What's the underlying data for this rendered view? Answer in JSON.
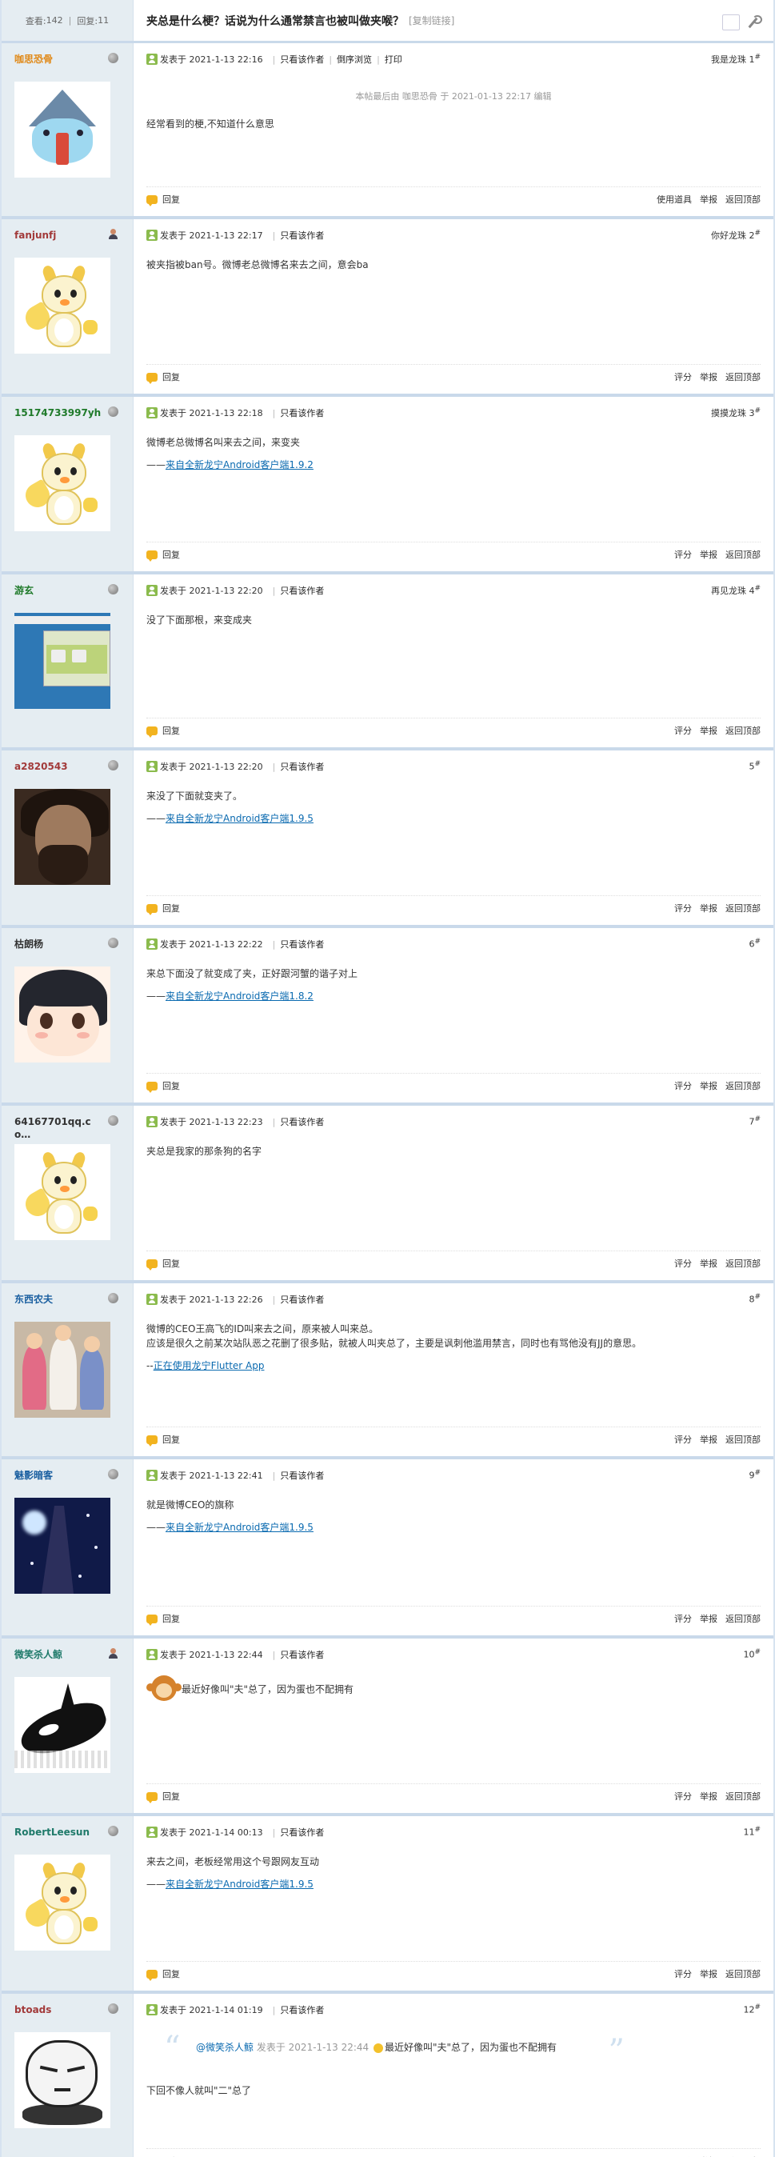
{
  "header": {
    "views_label": "查看:",
    "views_value": "142",
    "replies_label": "回复:",
    "replies_value": "11",
    "title": "夹总是什么梗？话说为什么通常禁言也被叫做夹喉？",
    "copy_link": "[复制链接]"
  },
  "labels": {
    "posted_at": "发表于",
    "only_author": "只看该作者",
    "reverse_view": "倒序浏览",
    "print": "打印",
    "reply": "回复",
    "use_tool": "使用道具",
    "rate": "评分",
    "report": "举报",
    "back_to_top": "返回顶部"
  },
  "colors": {
    "sidebar_bg": "#e5edf2",
    "border": "#c9d9ea",
    "link": "#0a6ab0"
  },
  "posts": [
    {
      "username": "咖思恐骨",
      "username_color": "#e08a1a",
      "time": "2021-1-13 22:16",
      "floor": "我是龙珠 1",
      "floor_sup": "#",
      "edit_note": "本帖最后由 咖思恐骨 于 2021-01-13 22:17 编辑",
      "body": "经常看到的梗,不知道什么意思"
    },
    {
      "username": "fanjunfj",
      "username_color": "#a23a3a",
      "time": "2021-1-13 22:17",
      "floor": "你好龙珠 2",
      "floor_sup": "#",
      "body": "被夹指被ban号。微博老总微博名来去之间，意会ba"
    },
    {
      "username": "15174733997yh",
      "username_color": "#1f7a2a",
      "time": "2021-1-13 22:18",
      "floor": "摸摸龙珠 3",
      "floor_sup": "#",
      "body": "微博老总微博名叫来去之间，来变夹",
      "sig_prefix": "——",
      "sig_link": "来自全新龙宁Android客户端1.9.2"
    },
    {
      "username": "游玄",
      "username_color": "#1f7a2a",
      "time": "2021-1-13 22:20",
      "floor": "再见龙珠 4",
      "floor_sup": "#",
      "body": "没了下面那根，来变成夹"
    },
    {
      "username": "a2820543",
      "username_color": "#a23a3a",
      "time": "2021-1-13 22:20",
      "floor": "5",
      "floor_sup": "#",
      "body": "来没了下面就变夹了。",
      "sig_prefix": "——",
      "sig_link": "来自全新龙宁Android客户端1.9.5"
    },
    {
      "username": "枯朗杨",
      "username_color": "#333333",
      "time": "2021-1-13 22:22",
      "floor": "6",
      "floor_sup": "#",
      "body": "来总下面没了就变成了夹，正好跟河蟹的谐子对上",
      "sig_prefix": "——",
      "sig_link": "来自全新龙宁Android客户端1.8.2"
    },
    {
      "username": "64167701qq.co…",
      "username_color": "#333333",
      "time": "2021-1-13 22:23",
      "floor": "7",
      "floor_sup": "#",
      "body": "夹总是我家的那条狗的名字"
    },
    {
      "username": "东西农夫",
      "username_color": "#1a5fa0",
      "time": "2021-1-13 22:26",
      "floor": "8",
      "floor_sup": "#",
      "body": "微博的CEO王高飞的ID叫来去之间，原来被人叫来总。",
      "body2": "应该是很久之前某次站队恶之花删了很多贴，就被人叫夹总了，主要是讽刺他滥用禁言，同时也有骂他没有JJ的意思。",
      "sig_prefix": "--",
      "sig_link": "正在使用龙宁Flutter App"
    },
    {
      "username": "魅影暗客",
      "username_color": "#1a5fa0",
      "time": "2021-1-13 22:41",
      "floor": "9",
      "floor_sup": "#",
      "body": "就是微博CEO的旗称",
      "sig_prefix": "——",
      "sig_link": "来自全新龙宁Android客户端1.9.5"
    },
    {
      "username": "微笑杀人鲸",
      "username_color": "#1f7a6a",
      "time": "2021-1-13 22:44",
      "floor": "10",
      "floor_sup": "#",
      "body": "最近好像叫\"夫\"总了，因为蛋也不配拥有"
    },
    {
      "username": "RobertLeesun",
      "username_color": "#1f7a6a",
      "time": "2021-1-14 00:13",
      "floor": "11",
      "floor_sup": "#",
      "body": "来去之间，老板经常用这个号跟网友互动",
      "sig_prefix": "——",
      "sig_link": "来自全新龙宁Android客户端1.9.5"
    },
    {
      "username": "btoads",
      "username_color": "#a23a3a",
      "time": "2021-1-14 01:19",
      "floor": "12",
      "floor_sup": "#",
      "quote_user": "@微笑杀人鲸",
      "quote_posted": "发表于 2021-1-13 22:44",
      "quote_text": "最近好像叫\"夫\"总了，因为蛋也不配拥有",
      "body": "下回不像人就叫\"二\"总了"
    }
  ]
}
